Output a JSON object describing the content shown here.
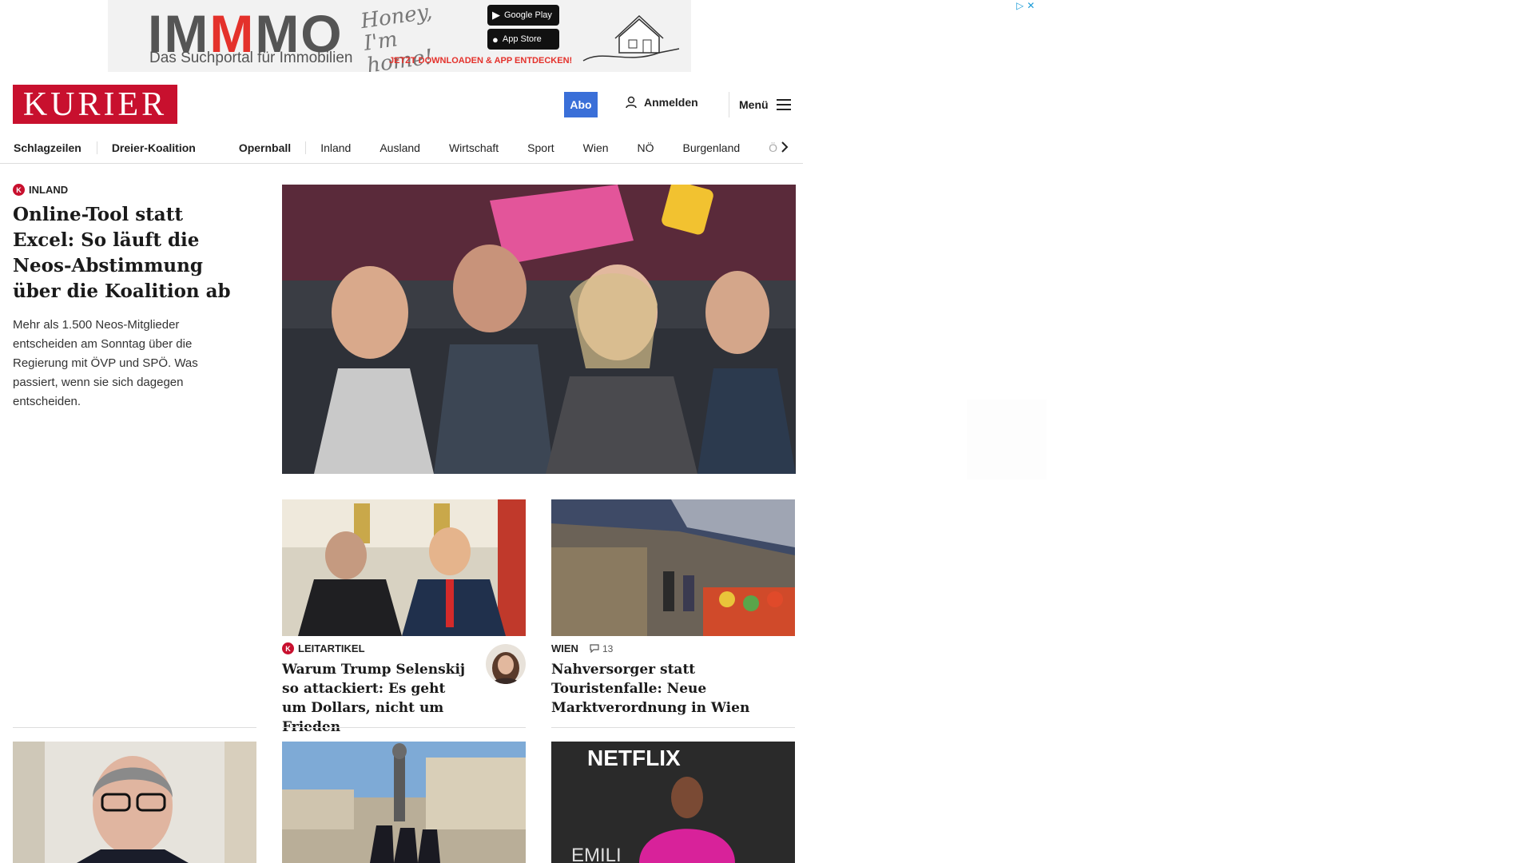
{
  "ad": {
    "logo_left": "IM",
    "logo_mid": "M",
    "logo_right": "MO",
    "tagline": "Das Suchportal für Immobilien",
    "script": "Honey, I'm home!",
    "google_play": "Google Play",
    "app_store": "App Store",
    "cta": "JETZT DOWNLOADEN & APP ENTDECKEN!",
    "choices_icon": "ad-choices-icon",
    "close_icon": "close-icon"
  },
  "header": {
    "logo": "KURIER",
    "abo": "Abo",
    "login": "Anmelden",
    "menu": "Menü"
  },
  "nav": {
    "items": [
      "Schlagzeilen",
      "Dreier-Koalition",
      "Opernball",
      "Inland",
      "Ausland",
      "Wirtschaft",
      "Sport",
      "Wien",
      "NÖ",
      "Burgenland",
      "Ö"
    ]
  },
  "main_story": {
    "kicker": "INLAND",
    "title": "Online-Tool statt Excel: So läuft die Neos-Abstimmung über die Koalition ab",
    "teaser": "Mehr als 1.500 Neos-Mitglieder entscheiden am Sonntag über die Regierung mit ÖVP und SPÖ. Was passiert, wenn sie sich dagegen entscheiden."
  },
  "cards": [
    {
      "kicker": "LEITARTIKEL",
      "title": "Warum Trump Selenskij so attackiert: Es geht um Dollars, nicht um Frieden"
    },
    {
      "kicker": "WIEN",
      "comments": "13",
      "title": "Nahversorger statt Touristenfalle: Neue Marktverordnung in Wien"
    }
  ],
  "colors": {
    "brand": "#c8102e",
    "abo": "#3a6fd8"
  }
}
